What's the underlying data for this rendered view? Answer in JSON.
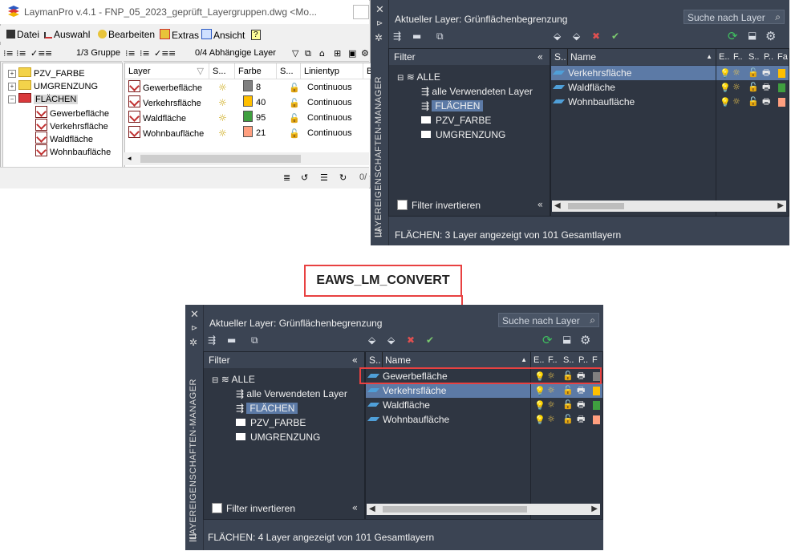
{
  "laymanpro": {
    "title": "LaymanPro v.4.1 - FNP_05_2023_geprüft_Layergruppen.dwg <Mo...",
    "menu": [
      "Datei",
      "Auswahl",
      "Bearbeiten",
      "Extras",
      "Ansicht",
      "?"
    ],
    "group_counter": "1/3 Gruppe",
    "dependent_counter": "0/4 Abhängige Layer",
    "tree": [
      {
        "label": "PZV_FARBE",
        "type": "folder",
        "expander": "+"
      },
      {
        "label": "UMGRENZUNG",
        "type": "folder",
        "expander": "+"
      },
      {
        "label": "FLÄCHEN",
        "type": "group",
        "expander": "−",
        "selected": true
      },
      {
        "label": "Gewerbefläche",
        "type": "layer"
      },
      {
        "label": "Verkehrsfläche",
        "type": "layer"
      },
      {
        "label": "Waldfläche",
        "type": "layer"
      },
      {
        "label": "Wohnbaufläche",
        "type": "layer"
      }
    ],
    "columns": [
      "Layer",
      "S...",
      "Farbe",
      "S...",
      "Linientyp",
      "B"
    ],
    "rows": [
      {
        "layer": "Gewerbefläche",
        "color_index": "8",
        "color_hex": "#808080",
        "linetype": "Continuous"
      },
      {
        "layer": "Verkehrsfläche",
        "color_index": "40",
        "color_hex": "#ffbf00",
        "linetype": "Continuous"
      },
      {
        "layer": "Waldfläche",
        "color_index": "95",
        "color_hex": "#3f9f3f",
        "linetype": "Continuous"
      },
      {
        "layer": "Wohnbaufläche",
        "color_index": "21",
        "color_hex": "#ff9f7f",
        "linetype": "Continuous"
      }
    ],
    "status_counter": "0/"
  },
  "palette_top": {
    "current_layer": "Aktueller Layer: Grünflächenbegrenzung",
    "search_placeholder": "Suche nach Layer",
    "filter_header": "Filter",
    "name_header": "Name",
    "s_header": "S..",
    "prop_headers": [
      "E..",
      "F..",
      "S..",
      "P..",
      "Fa"
    ],
    "filter_tree": [
      "ALLE",
      "alle Verwendeten Layer",
      "FLÄCHEN",
      "PZV_FARBE",
      "UMGRENZUNG"
    ],
    "layers": [
      "Verkehrsfläche",
      "Waldfläche",
      "Wohnbaufläche"
    ],
    "layer_colors": [
      "#ffbf00",
      "#3f9f3f",
      "#ff9f7f"
    ],
    "invert_filter": "Filter invertieren",
    "status": "FLÄCHEN: 3 Layer angezeigt von 101 Gesamtlayern",
    "side_title": "LAYEREIGENSCHAFTEN-MANAGER"
  },
  "callout": {
    "label": "EAWS_LM_CONVERT"
  },
  "palette_bottom": {
    "current_layer": "Aktueller Layer: Grünflächenbegrenzung",
    "search_placeholder": "Suche nach Layer",
    "filter_header": "Filter",
    "name_header": "Name",
    "s_header": "S..",
    "prop_headers": [
      "E..",
      "F..",
      "S..",
      "P..",
      "F"
    ],
    "filter_tree": [
      "ALLE",
      "alle Verwendeten Layer",
      "FLÄCHEN",
      "PZV_FARBE",
      "UMGRENZUNG"
    ],
    "layers": [
      "Gewerbefläche",
      "Verkehrsfläche",
      "Waldfläche",
      "Wohnbaufläche"
    ],
    "layer_colors": [
      "#808080",
      "#ffbf00",
      "#3f9f3f",
      "#ff9f7f"
    ],
    "invert_filter": "Filter invertieren",
    "status": "FLÄCHEN: 4 Layer angezeigt von 101 Gesamtlayern",
    "side_title": "LAYEREIGENSCHAFTEN-MANAGER"
  },
  "colors": {
    "callout_red": "#e84141",
    "palette_bg": "#3b4453",
    "selection_blue": "#5c7aa6"
  }
}
